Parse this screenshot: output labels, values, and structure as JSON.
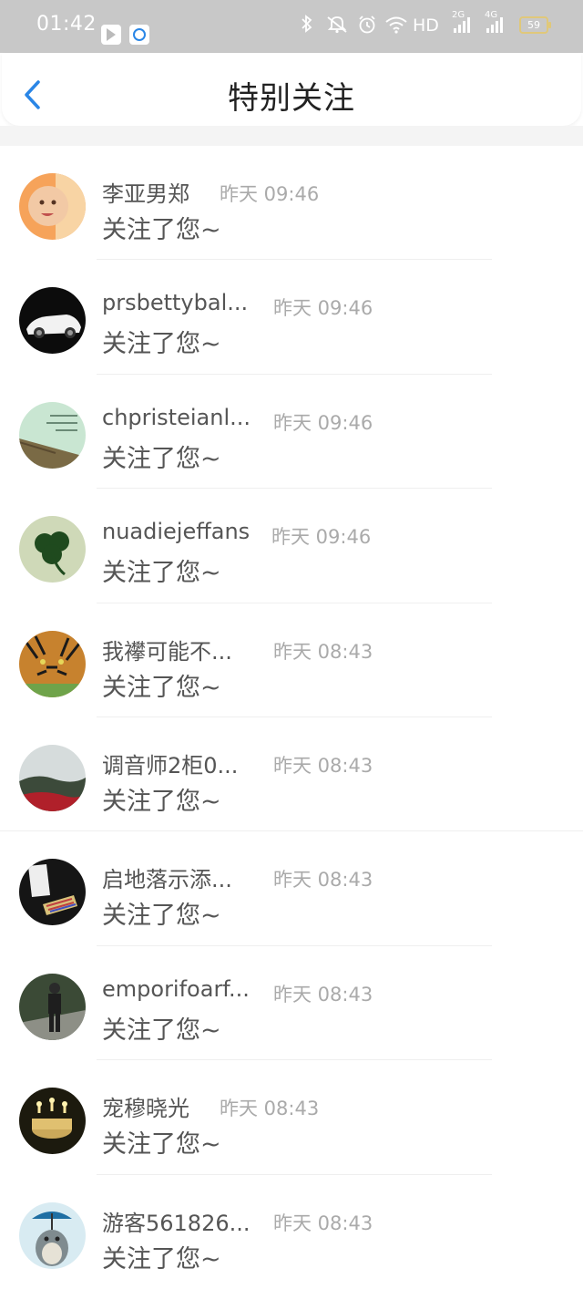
{
  "status_bar": {
    "time": "01:42",
    "network_hd": "HD",
    "network_2g": "2G",
    "network_4g": "4G",
    "battery": "59"
  },
  "header": {
    "title": "特别关注"
  },
  "rows": [
    {
      "name": "李亚男郑",
      "time": "昨天 09:46",
      "message": "关注了您~"
    },
    {
      "name": "prsbettybal...",
      "time": "昨天 09:46",
      "message": "关注了您~"
    },
    {
      "name": "chpristeianl...",
      "time": "昨天 09:46",
      "message": "关注了您~"
    },
    {
      "name": "nuadiejeffans",
      "time": "昨天 09:46",
      "message": "关注了您~"
    },
    {
      "name": "我襻可能不...",
      "time": "昨天 08:43",
      "message": "关注了您~"
    },
    {
      "name": "调音师2柜0...",
      "time": "昨天 08:43",
      "message": "关注了您~"
    },
    {
      "name": "启地落示添...",
      "time": "昨天 08:43",
      "message": "关注了您~"
    },
    {
      "name": "emporifoarf...",
      "time": "昨天 08:43",
      "message": "关注了您~"
    },
    {
      "name": "宠穆晓光",
      "time": "昨天 08:43",
      "message": "关注了您~"
    },
    {
      "name": "游客561826...",
      "time": "昨天 08:43",
      "message": "关注了您~"
    }
  ],
  "colors": {
    "accent": "#2a86e6",
    "status_bar_bg": "#c8c8c8",
    "name_text": "#555555",
    "time_text": "#aaaaaa"
  }
}
